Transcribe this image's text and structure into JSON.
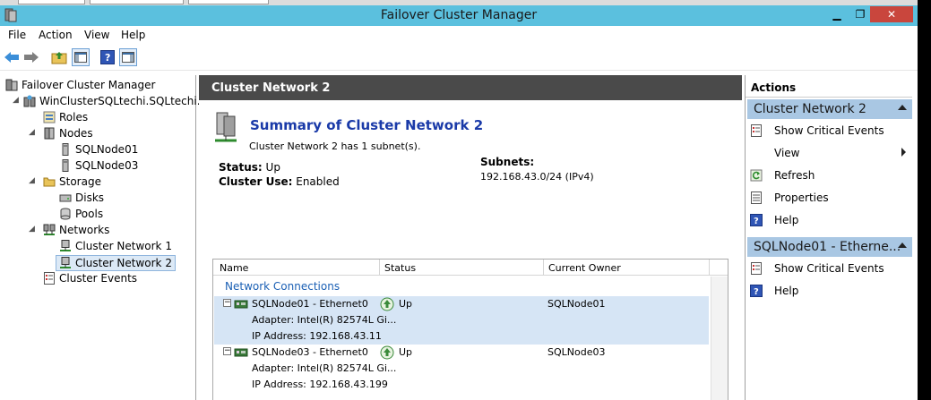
{
  "window": {
    "title": "Failover Cluster Manager"
  },
  "menu": [
    "File",
    "Action",
    "View",
    "Help"
  ],
  "tree": {
    "root": "Failover Cluster Manager",
    "cluster": "WinClusterSQLtechi.SQLtechi.cc",
    "roles": "Roles",
    "nodes": "Nodes",
    "node1": "SQLNode01",
    "node3": "SQLNode03",
    "storage": "Storage",
    "disks": "Disks",
    "pools": "Pools",
    "networks": "Networks",
    "net1": "Cluster Network 1",
    "net2": "Cluster Network 2",
    "events": "Cluster Events"
  },
  "center": {
    "header": "Cluster Network 2",
    "summary_title": "Summary of Cluster Network 2",
    "summary_sub": "Cluster Network 2 has 1 subnet(s).",
    "status_label": "Status:",
    "status_value": "Up",
    "use_label": "Cluster Use:",
    "use_value": "Enabled",
    "subnets_label": "Subnets:",
    "subnets_value": "192.168.43.0/24 (IPv4)",
    "grid": {
      "columns": [
        "Name",
        "Status",
        "Current Owner"
      ],
      "group": "Network Connections",
      "rows": [
        {
          "name": "SQLNode01 - Ethernet0",
          "status": "Up",
          "owner": "SQLNode01",
          "adapter": "Adapter: Intel(R) 82574L Gi...",
          "ip": "IP Address: 192.168.43.11"
        },
        {
          "name": "SQLNode03 - Ethernet0",
          "status": "Up",
          "owner": "SQLNode03",
          "adapter": "Adapter: Intel(R) 82574L Gi...",
          "ip": "IP Address: 192.168.43.199"
        }
      ]
    }
  },
  "actions": {
    "title": "Actions",
    "section1": {
      "header": "Cluster Network 2",
      "items": [
        "Show Critical Events",
        "View",
        "Refresh",
        "Properties",
        "Help"
      ]
    },
    "section2": {
      "header": "SQLNode01 - Etherne...",
      "items": [
        "Show Critical Events",
        "Help"
      ]
    }
  }
}
